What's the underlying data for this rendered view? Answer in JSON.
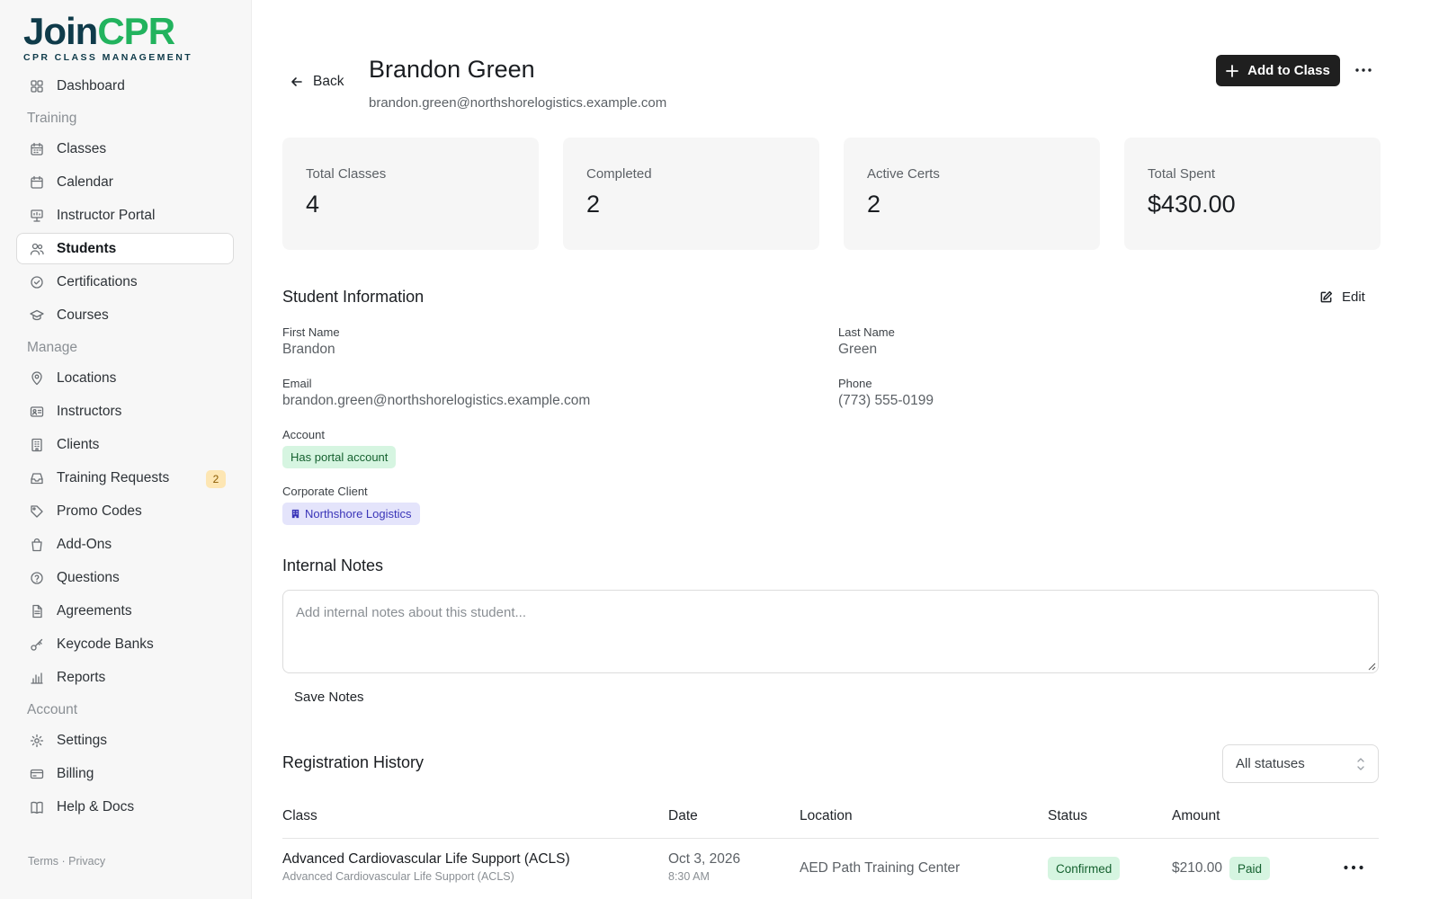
{
  "brand": {
    "name_part1": "Join",
    "name_part2": "CPR",
    "tagline": "CPR CLASS MANAGEMENT"
  },
  "sidebar": {
    "items": [
      {
        "type": "item",
        "label": "Dashboard",
        "icon": "grid-icon"
      },
      {
        "type": "section",
        "label": "Training"
      },
      {
        "type": "item",
        "label": "Classes",
        "icon": "calendar-grid-icon"
      },
      {
        "type": "item",
        "label": "Calendar",
        "icon": "calendar-icon"
      },
      {
        "type": "item",
        "label": "Instructor Portal",
        "icon": "presentation-icon"
      },
      {
        "type": "item",
        "label": "Students",
        "icon": "users-icon",
        "active": true
      },
      {
        "type": "item",
        "label": "Certifications",
        "icon": "check-badge-icon"
      },
      {
        "type": "item",
        "label": "Courses",
        "icon": "graduation-cap-icon"
      },
      {
        "type": "section",
        "label": "Manage"
      },
      {
        "type": "item",
        "label": "Locations",
        "icon": "map-pin-icon"
      },
      {
        "type": "item",
        "label": "Instructors",
        "icon": "id-card-icon"
      },
      {
        "type": "item",
        "label": "Clients",
        "icon": "building-icon"
      },
      {
        "type": "item",
        "label": "Training Requests",
        "icon": "inbox-icon",
        "badge": "2"
      },
      {
        "type": "item",
        "label": "Promo Codes",
        "icon": "tag-icon"
      },
      {
        "type": "item",
        "label": "Add-Ons",
        "icon": "shopping-bag-icon"
      },
      {
        "type": "item",
        "label": "Questions",
        "icon": "help-circle-icon"
      },
      {
        "type": "item",
        "label": "Agreements",
        "icon": "file-text-icon"
      },
      {
        "type": "item",
        "label": "Keycode Banks",
        "icon": "key-icon"
      },
      {
        "type": "item",
        "label": "Reports",
        "icon": "bar-chart-icon"
      },
      {
        "type": "section",
        "label": "Account"
      },
      {
        "type": "item",
        "label": "Settings",
        "icon": "gear-icon"
      },
      {
        "type": "item",
        "label": "Billing",
        "icon": "credit-card-icon"
      },
      {
        "type": "item",
        "label": "Help & Docs",
        "icon": "book-icon"
      }
    ],
    "footer": "Terms · Privacy"
  },
  "header": {
    "back_label": "Back",
    "name": "Brandon Green",
    "email": "brandon.green@northshorelogistics.example.com",
    "add_label": "Add to Class"
  },
  "stats": [
    {
      "label": "Total Classes",
      "value": "4"
    },
    {
      "label": "Completed",
      "value": "2"
    },
    {
      "label": "Active Certs",
      "value": "2"
    },
    {
      "label": "Total Spent",
      "value": "$430.00"
    }
  ],
  "info": {
    "title": "Student Information",
    "edit_label": "Edit",
    "first_name_label": "First Name",
    "first_name": "Brandon",
    "last_name_label": "Last Name",
    "last_name": "Green",
    "email_label": "Email",
    "email": "brandon.green@northshorelogistics.example.com",
    "phone_label": "Phone",
    "phone": "(773) 555-0199",
    "account_label": "Account",
    "account_value": "Has portal account",
    "client_label": "Corporate Client",
    "client_value": "Northshore Logistics"
  },
  "notes": {
    "title": "Internal Notes",
    "placeholder": "Add internal notes about this student...",
    "save_label": "Save Notes"
  },
  "registrations": {
    "title": "Registration History",
    "filter_value": "All statuses",
    "columns": [
      "Class",
      "Date",
      "Location",
      "Status",
      "Amount"
    ],
    "rows": [
      {
        "class": "Advanced Cardiovascular Life Support (ACLS)",
        "class_sub": "Advanced Cardiovascular Life Support (ACLS)",
        "date": "Oct 3, 2026",
        "time": "8:30 AM",
        "location": "AED Path Training Center",
        "status": "Confirmed",
        "amount": "$210.00",
        "payment": "Paid"
      }
    ]
  },
  "colors": {
    "accent_dark": "#1f1f1f",
    "brand_green": "#22b35e",
    "brand_navy": "#0f3b4a"
  }
}
